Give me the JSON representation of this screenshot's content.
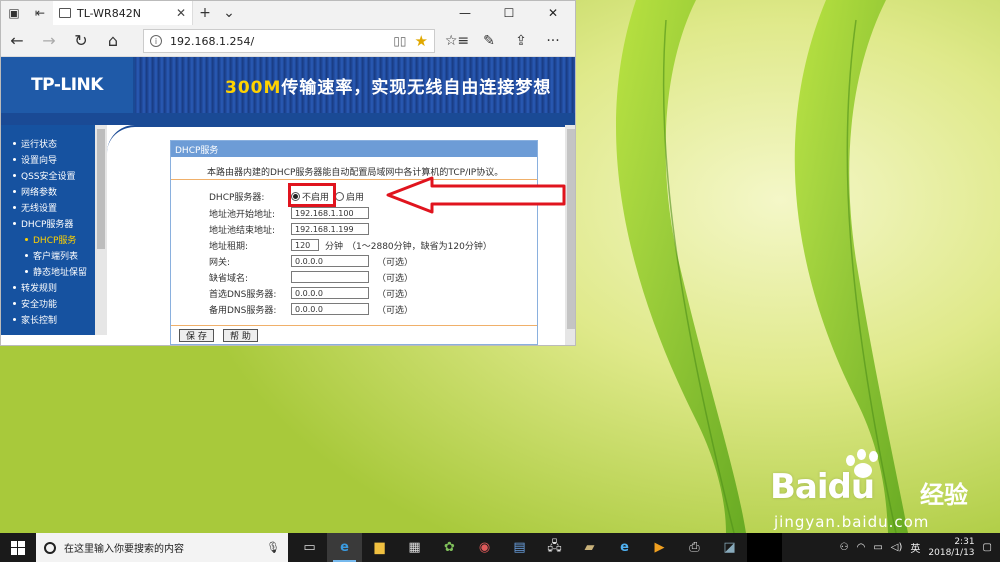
{
  "browser": {
    "tab_title": "TL-WR842N",
    "address_url": "192.168.1.254/"
  },
  "banner": {
    "logo": "TP-LINK",
    "slogan_highlight": "300M",
    "slogan_rest": "传输速率，实现无线自由连接梦想"
  },
  "sidebar": {
    "items": [
      {
        "label": "运行状态"
      },
      {
        "label": "设置向导"
      },
      {
        "label": "QSS安全设置"
      },
      {
        "label": "网络参数"
      },
      {
        "label": "无线设置"
      },
      {
        "label": "DHCP服务器"
      },
      {
        "label": "DHCP服务"
      },
      {
        "label": "客户端列表"
      },
      {
        "label": "静态地址保留"
      },
      {
        "label": "转发规则"
      },
      {
        "label": "安全功能"
      },
      {
        "label": "家长控制"
      }
    ]
  },
  "panel": {
    "title": "DHCP服务",
    "description": "本路由器内建的DHCP服务器能自动配置局域网中各计算机的TCP/IP协议。",
    "dhcp_label": "DHCP服务器:",
    "option_off": "不启用",
    "option_on": "启用",
    "selected": "不启用",
    "start_label": "地址池开始地址:",
    "start_value": "192.168.1.100",
    "end_label": "地址池结束地址:",
    "end_value": "192.168.1.199",
    "lease_label": "地址租期:",
    "lease_value": "120",
    "lease_unit": "分钟",
    "lease_note": "（1～2880分钟，缺省为120分钟）",
    "gateway_label": "网关:",
    "gateway_value": "0.0.0.0",
    "domain_label": "缺省域名:",
    "domain_value": "",
    "dns1_label": "首选DNS服务器:",
    "dns1_value": "0.0.0.0",
    "dns2_label": "备用DNS服务器:",
    "dns2_value": "0.0.0.0",
    "optional": "（可选）",
    "save_label": "保 存",
    "help_label": "帮 助"
  },
  "taskbar": {
    "search_placeholder": "在这里输入你要搜索的内容",
    "ime": "英",
    "time": "2:31",
    "date": "2018/1/13"
  },
  "watermark": {
    "logo": "Baidu",
    "word": "经验",
    "url": "jingyan.baidu.com"
  },
  "colors": {
    "router_blue": "#1a4a95",
    "panel_title": "#6d9cd6",
    "highlight_red": "#e0141e",
    "menu_active": "#ffd200"
  }
}
